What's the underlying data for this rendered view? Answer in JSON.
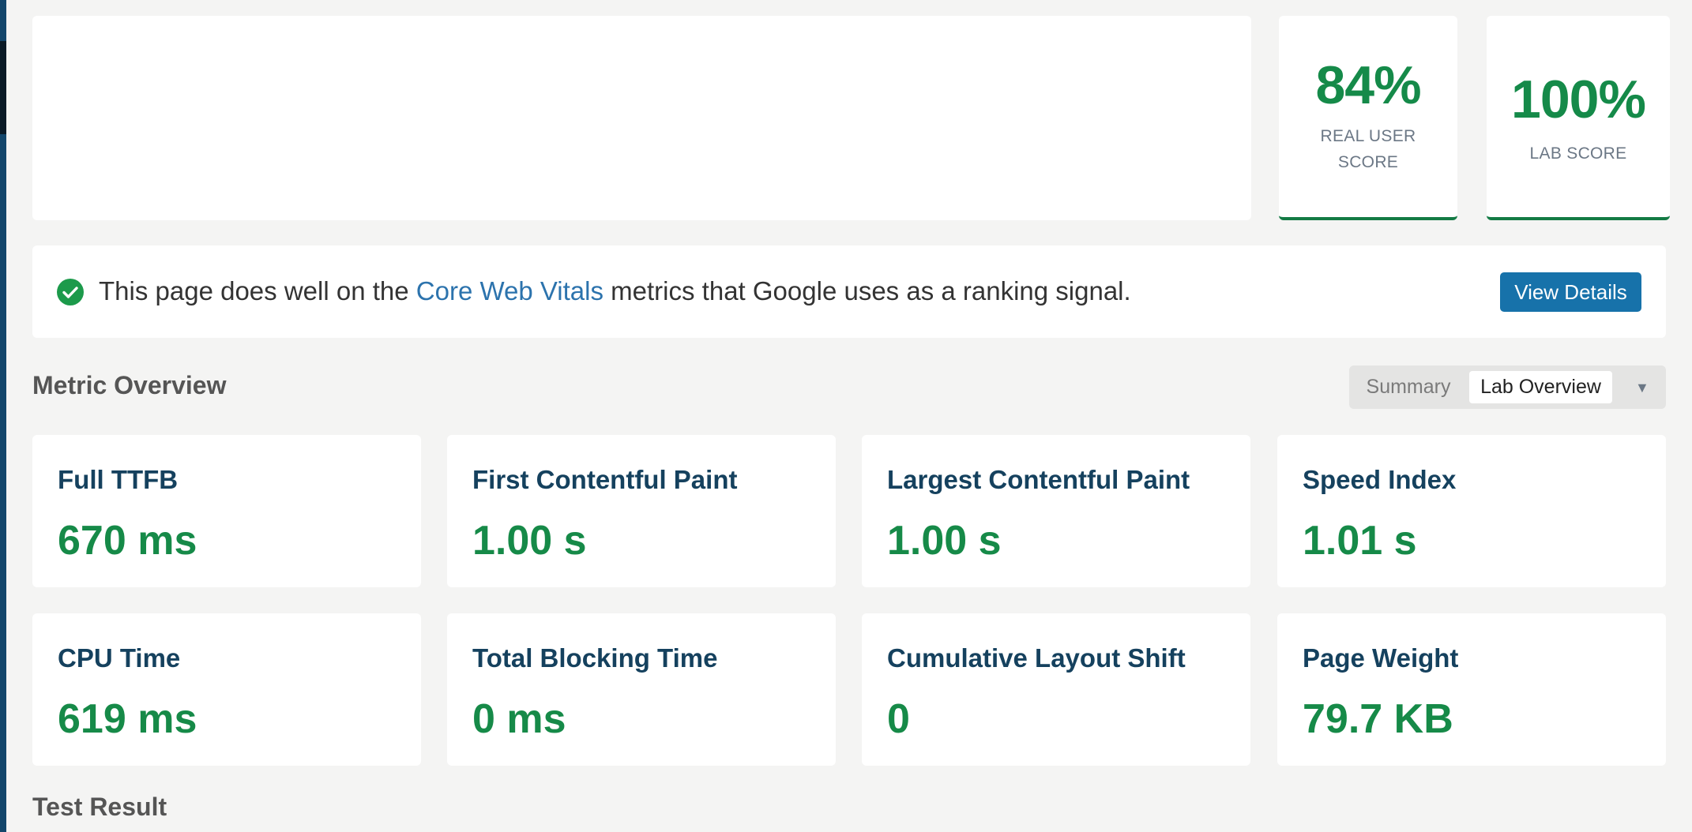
{
  "scores": {
    "real_user": {
      "value": "84%",
      "label": "REAL USER SCORE"
    },
    "lab": {
      "value": "100%",
      "label": "LAB SCORE"
    }
  },
  "notice": {
    "text_before": "This page does well on the ",
    "link_text": "Core Web Vitals",
    "text_after": " metrics that Google uses as a ranking signal.",
    "button_label": "View Details"
  },
  "metric_overview": {
    "title": "Metric Overview",
    "toggle": {
      "options": [
        "Summary",
        "Lab Overview"
      ],
      "selected": "Lab Overview"
    },
    "metrics": [
      {
        "label": "Full TTFB",
        "value": "670 ms"
      },
      {
        "label": "First Contentful Paint",
        "value": "1.00 s"
      },
      {
        "label": "Largest Contentful Paint",
        "value": "1.00 s"
      },
      {
        "label": "Speed Index",
        "value": "1.01 s"
      },
      {
        "label": "CPU Time",
        "value": "619 ms"
      },
      {
        "label": "Total Blocking Time",
        "value": "0 ms"
      },
      {
        "label": "Cumulative Layout Shift",
        "value": "0"
      },
      {
        "label": "Page Weight",
        "value": "79.7 KB"
      }
    ]
  },
  "test_result": {
    "title": "Test Result"
  },
  "colors": {
    "good_green": "#158a49",
    "link_blue": "#2c73ad",
    "button_blue": "#1772aa",
    "metric_label": "#15415e"
  }
}
